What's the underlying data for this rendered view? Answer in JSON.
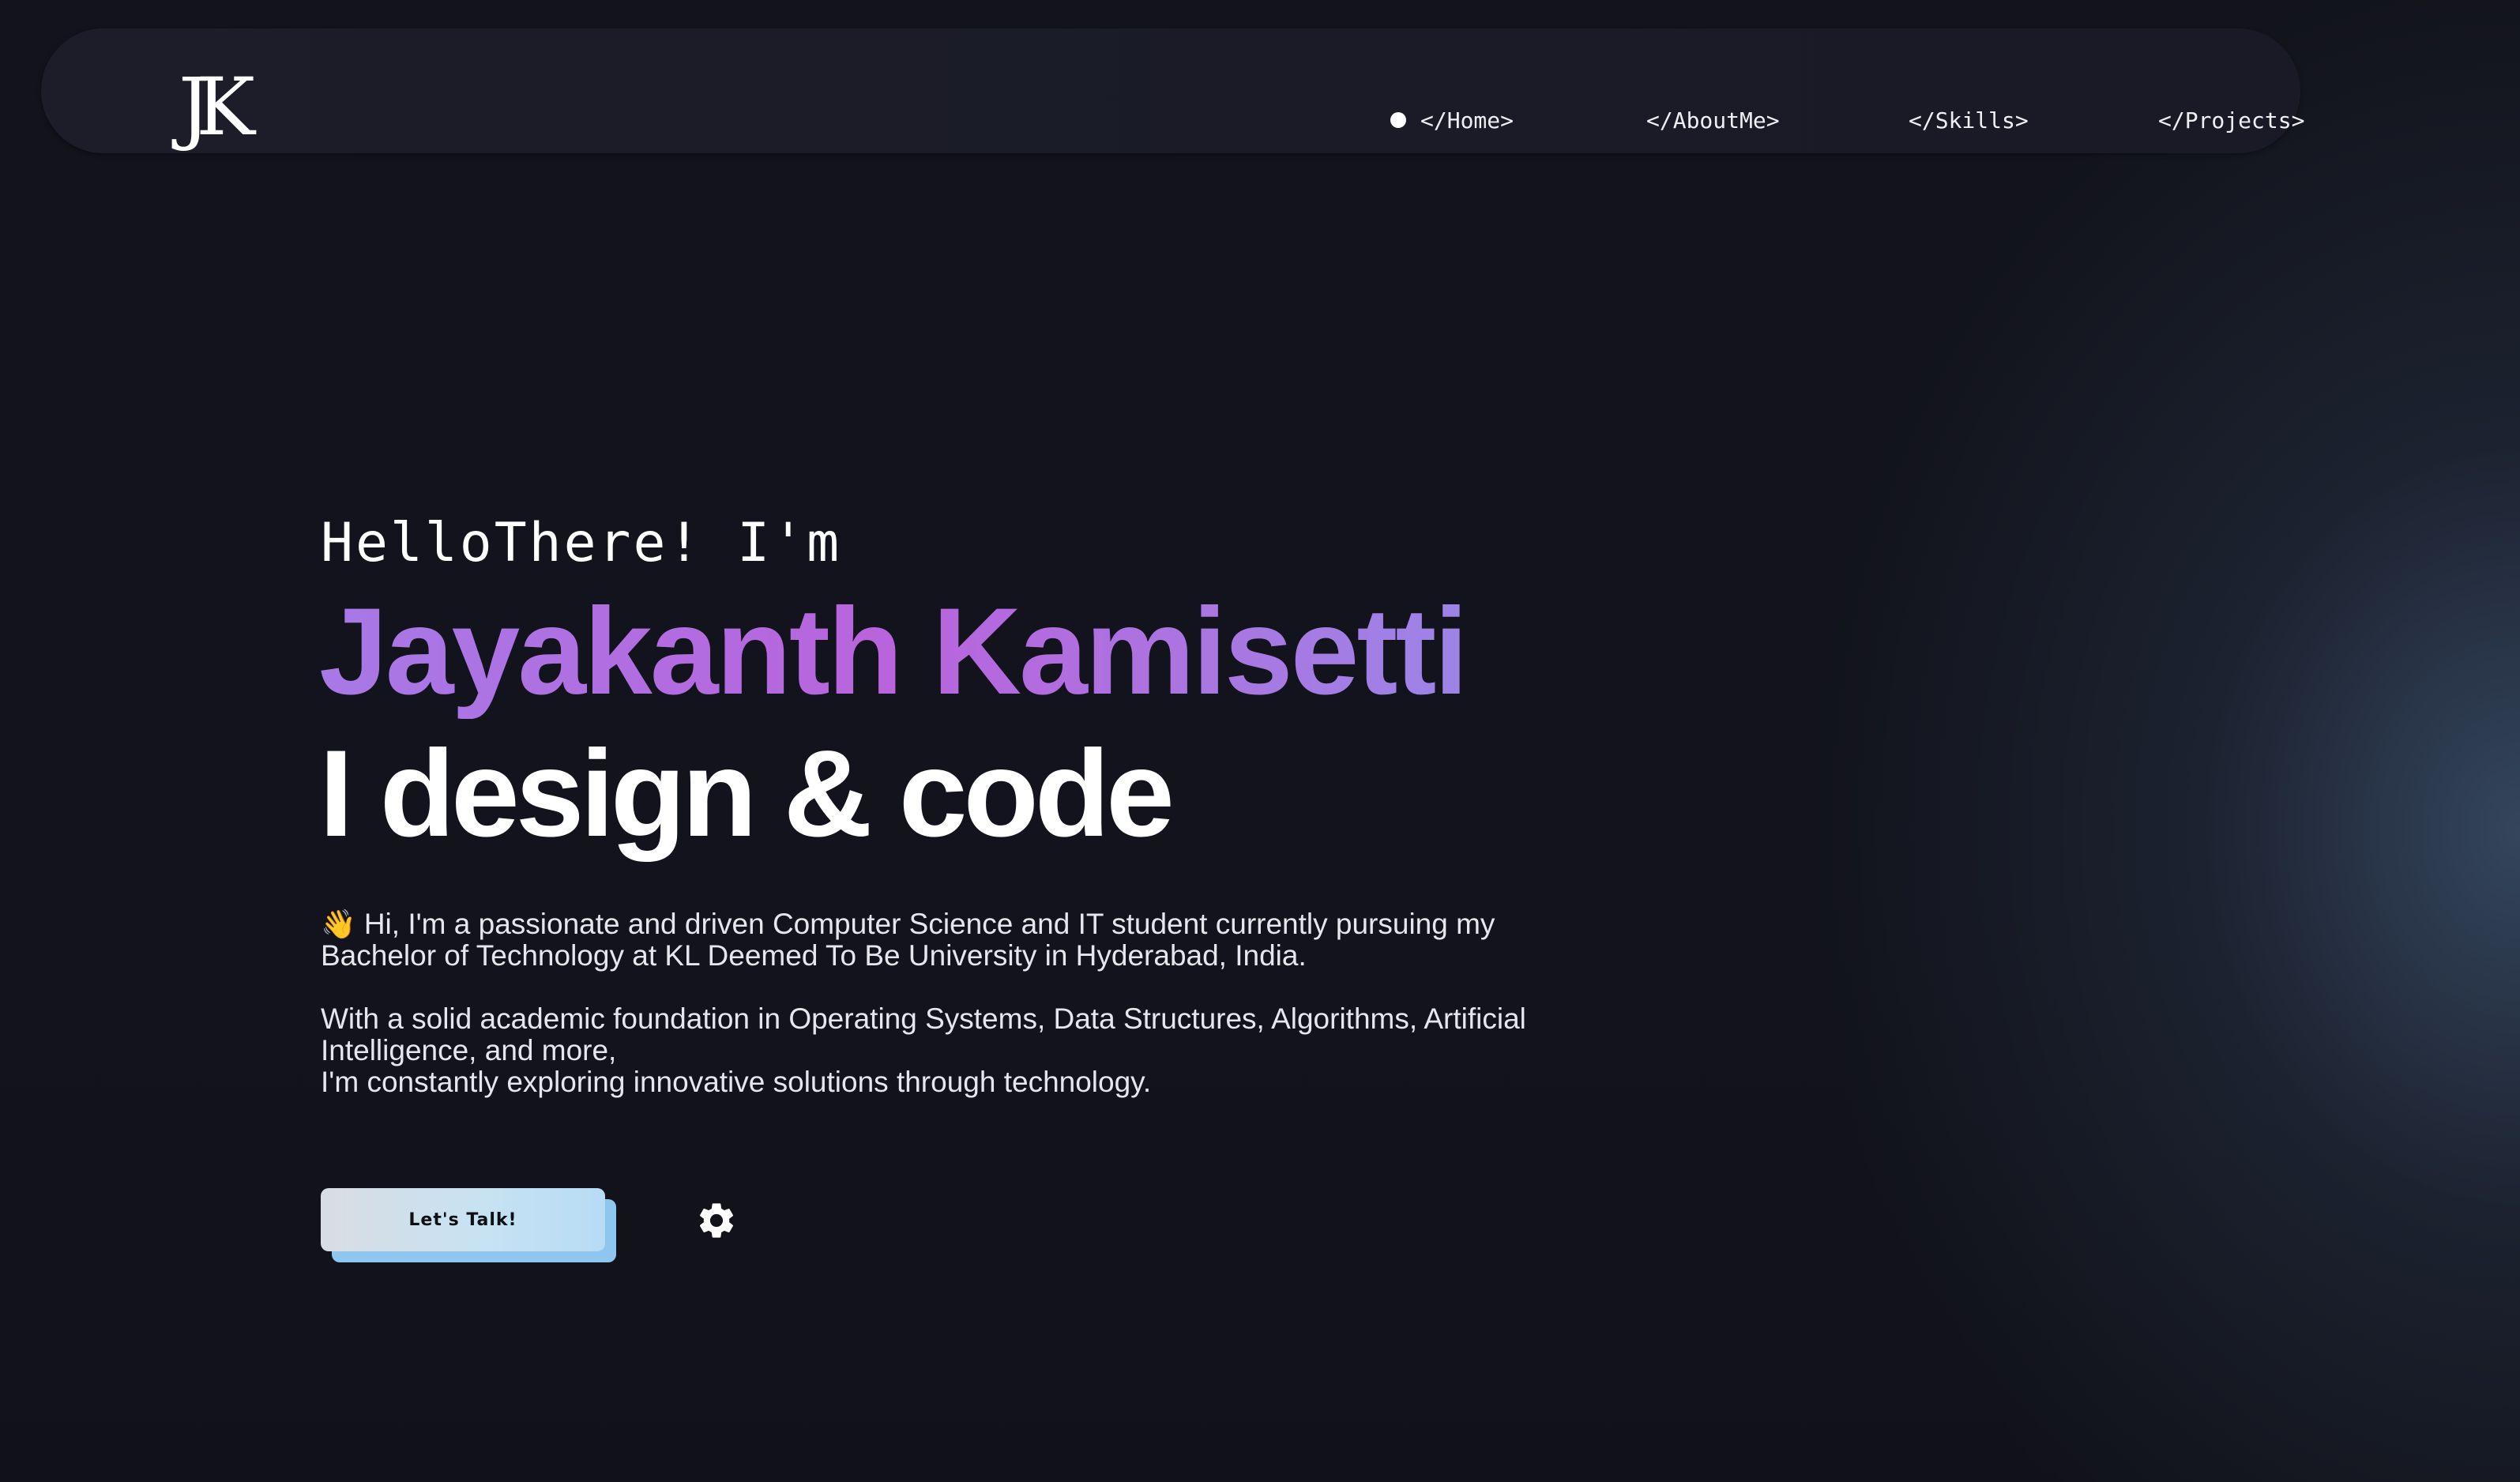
{
  "navbar": {
    "logo": "JK",
    "items": [
      {
        "label": "</Home>",
        "active": true
      },
      {
        "label": "</AboutMe>"
      },
      {
        "label": "</Skills>"
      },
      {
        "label": "</Projects>"
      }
    ]
  },
  "hero": {
    "greeting": "HelloThere! I'm",
    "name": "Jayakanth Kamisetti",
    "tagline": "I design & code",
    "intro": {
      "wave_emoji": "👋",
      "paragraph1": "Hi, I'm a passionate and driven Computer Science and IT student currently pursuing my Bachelor of Technology at KL Deemed To Be University in Hyderabad, India.",
      "paragraph2_line1": "With a solid academic foundation in Operating Systems, Data Structures, Algorithms, Artificial Intelligence, and more,",
      "paragraph2_line2": "I'm constantly exploring innovative solutions through technology."
    },
    "cta_label": "Let's Talk!",
    "settings_icon": "gear-icon"
  },
  "colors": {
    "background": "#12131b",
    "navbar": "#1b1c28",
    "name_gradient_start": "#a779e6",
    "name_gradient_mid": "#b964dc",
    "cta_fill": "#c8e2f2",
    "cta_shadow": "#8ec6f0"
  }
}
